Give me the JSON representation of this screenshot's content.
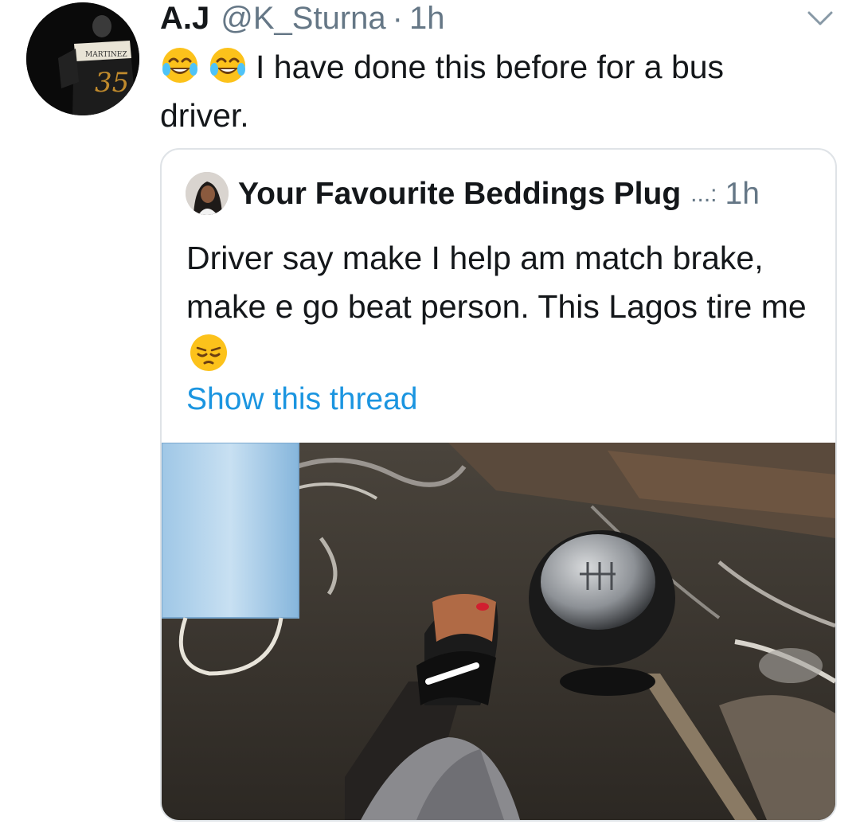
{
  "tweet": {
    "display_name": "A.J",
    "handle": "@K_Sturna",
    "separator": "·",
    "time": "1h",
    "text_after_emoji": "I have done this before for a bus driver.",
    "emojis": [
      "face-with-tears-of-joy",
      "face-with-tears-of-joy"
    ],
    "menu_icon": "chevron-down-icon"
  },
  "quote": {
    "display_name": "Your Favourite Beddings Plug",
    "ellipsis": "...:",
    "time": "1h",
    "text": "Driver say make I help am match brake, make e go beat person. This Lagos tire me",
    "trailing_emoji": "pensive-face",
    "show_thread": "Show this thread",
    "photo_icon": "photo-car-pedals-gear-stick"
  },
  "colors": {
    "link": "#1b95e0",
    "muted": "#657786",
    "text": "#14171a",
    "border": "#dfe3e7"
  }
}
